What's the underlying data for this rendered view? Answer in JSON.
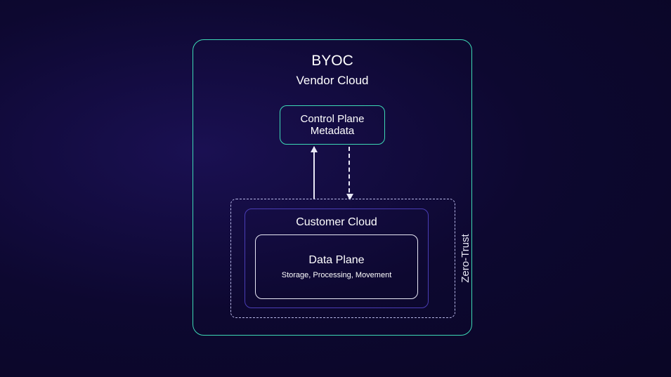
{
  "byoc": {
    "title": "BYOC",
    "subtitle": "Vendor Cloud"
  },
  "controlPlane": {
    "line1": "Control Plane",
    "line2": "Metadata"
  },
  "zeroTrust": {
    "label": "Zero-Trust"
  },
  "customerCloud": {
    "title": "Customer Cloud"
  },
  "dataPlane": {
    "title": "Data Plane",
    "subtitle": "Storage, Processing, Movement"
  }
}
